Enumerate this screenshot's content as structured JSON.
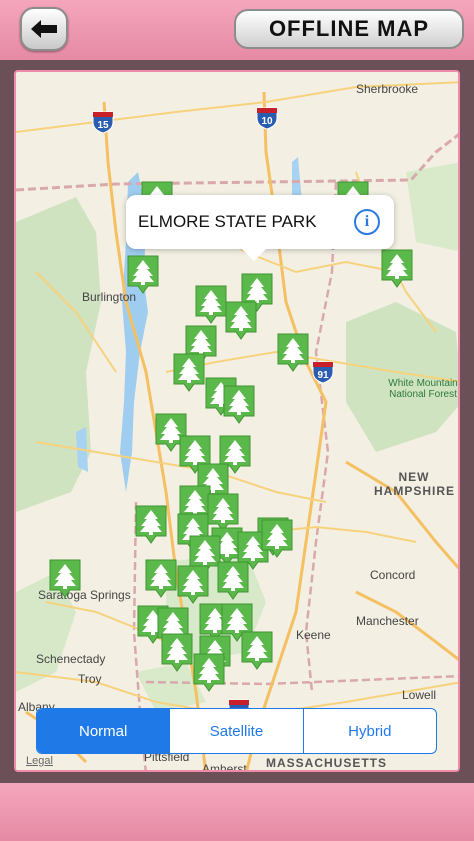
{
  "header": {
    "title": "OFFLINE MAP",
    "back_icon": "arrow-left-icon"
  },
  "map": {
    "callout": {
      "title": "ELMORE STATE PARK",
      "icon": "info-icon",
      "icon_glyph": "i"
    },
    "places": {
      "sherbrooke": "Sherbrooke",
      "burlington": "Burlington",
      "saratoga": "Saratoga Springs",
      "schenectady": "Schenectady",
      "troy": "Troy",
      "albany": "Albany",
      "concord": "Concord",
      "manchester": "Manchester",
      "keene": "Keene",
      "lowell": "Lowell",
      "amherst": "Amherst",
      "pittsfield": "Pittsfield"
    },
    "states": {
      "new_hampshire": "NEW\nHAMPSHIRE",
      "massachusetts": "MASSACHUSETTS"
    },
    "forest": "White Mountain\nNational Forest",
    "highways": {
      "i15": "15",
      "i10": "10",
      "i91": "91",
      "i91b": "91"
    },
    "marker_icon": "tree-marker-icon",
    "marker_color": "#5bb84a"
  },
  "map_type": {
    "options": [
      "Normal",
      "Satellite",
      "Hybrid"
    ],
    "selected": "Normal"
  },
  "legal": "Legal"
}
